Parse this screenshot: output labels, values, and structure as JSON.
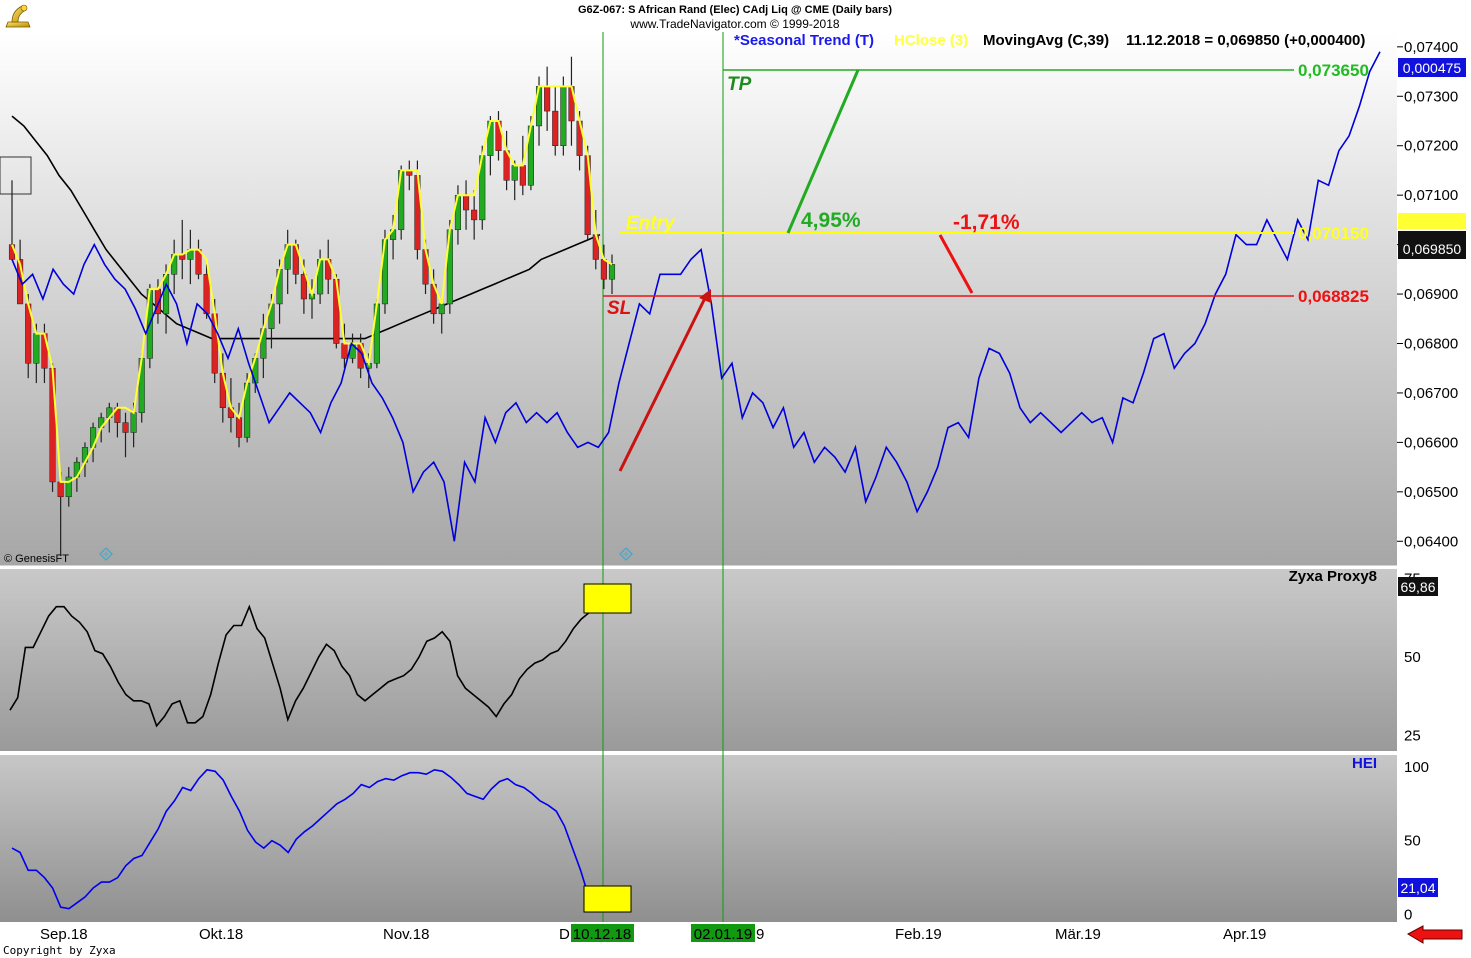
{
  "header": {
    "title": "G6Z-067:  S African Rand (Elec) CAdj Liq @ CME  (Daily bars)",
    "subtitle": "www.TradeNavigator.com © 1999-2018"
  },
  "legend": {
    "seasonal": "*Seasonal Trend (T)",
    "hclose": "HClose (3)",
    "ma": "MovingAvg (C,39)",
    "reading": "11.12.2018 = 0,069850 (+0,000400)"
  },
  "watermark": "© GenesisFT",
  "copyright": "Copyright by Zyxa",
  "colors": {
    "price_bg_top": "#ffffff",
    "price_bg_bottom": "#a8a8a8",
    "seasonal": "#0000dd",
    "hclose": "#ffff33",
    "ma": "#000000",
    "bull": "#22aa22",
    "bear": "#dd2222",
    "entry": "#ffff00",
    "tp": "#22aa22",
    "sl": "#ee1111",
    "hei": "#0000ee",
    "zyxa": "#000000",
    "date_box": "#119911"
  },
  "chart_data": [
    {
      "type": "candlestick",
      "panel": "price",
      "ylim": [
        0.0635,
        0.0743
      ],
      "y_ticks": [
        "0,07400",
        "0,07300",
        "0,07200",
        "0,07100",
        "0,07000",
        "0,06900",
        "0,06800",
        "0,06700",
        "0,06600",
        "0,06500",
        "0,06400"
      ],
      "y_tick_values": [
        0.074,
        0.073,
        0.072,
        0.071,
        0.07,
        0.069,
        0.068,
        0.067,
        0.066,
        0.065,
        0.064
      ],
      "x_ticks": [
        "Sep.18",
        "Okt.18",
        "Nov.18",
        "D",
        "Feb.19",
        "Mär.19",
        "Apr.19",
        "9"
      ],
      "ohlc": [
        [
          0.07,
          0.0713,
          0.0697,
          0.0697
        ],
        [
          0.0697,
          0.0701,
          0.0688,
          0.0688
        ],
        [
          0.0688,
          0.069,
          0.0673,
          0.0676
        ],
        [
          0.0676,
          0.0684,
          0.0672,
          0.0682
        ],
        [
          0.0682,
          0.0684,
          0.0672,
          0.0675
        ],
        [
          0.0675,
          0.0676,
          0.065,
          0.0652
        ],
        [
          0.0652,
          0.0654,
          0.0637,
          0.0649
        ],
        [
          0.0649,
          0.0655,
          0.0647,
          0.0653
        ],
        [
          0.0653,
          0.0657,
          0.065,
          0.0656
        ],
        [
          0.0656,
          0.066,
          0.0653,
          0.0659
        ],
        [
          0.0659,
          0.0664,
          0.0656,
          0.0663
        ],
        [
          0.0663,
          0.0666,
          0.066,
          0.0665
        ],
        [
          0.0665,
          0.0668,
          0.0662,
          0.0667
        ],
        [
          0.0667,
          0.0668,
          0.0661,
          0.0664
        ],
        [
          0.0664,
          0.0666,
          0.0657,
          0.0662
        ],
        [
          0.0662,
          0.0668,
          0.0659,
          0.0666
        ],
        [
          0.0666,
          0.0678,
          0.0664,
          0.0677
        ],
        [
          0.0677,
          0.0692,
          0.0675,
          0.0691
        ],
        [
          0.0691,
          0.0693,
          0.0684,
          0.0686
        ],
        [
          0.0686,
          0.0696,
          0.0682,
          0.0694
        ],
        [
          0.0694,
          0.0701,
          0.069,
          0.0698
        ],
        [
          0.0698,
          0.0705,
          0.0693,
          0.0697
        ],
        [
          0.0697,
          0.0703,
          0.0692,
          0.0699
        ],
        [
          0.0699,
          0.0701,
          0.0693,
          0.0694
        ],
        [
          0.0694,
          0.0696,
          0.0685,
          0.0686
        ],
        [
          0.0686,
          0.0689,
          0.0672,
          0.0674
        ],
        [
          0.0674,
          0.0678,
          0.0664,
          0.0667
        ],
        [
          0.0667,
          0.0673,
          0.0662,
          0.0665
        ],
        [
          0.0665,
          0.0668,
          0.0659,
          0.0661
        ],
        [
          0.0661,
          0.0674,
          0.066,
          0.0672
        ],
        [
          0.0672,
          0.0678,
          0.067,
          0.0677
        ],
        [
          0.0677,
          0.0686,
          0.0673,
          0.0683
        ],
        [
          0.0683,
          0.069,
          0.0679,
          0.0688
        ],
        [
          0.0688,
          0.0697,
          0.0684,
          0.0695
        ],
        [
          0.0695,
          0.0703,
          0.069,
          0.07
        ],
        [
          0.07,
          0.0701,
          0.0692,
          0.0694
        ],
        [
          0.0694,
          0.0697,
          0.0686,
          0.0689
        ],
        [
          0.0689,
          0.0693,
          0.0685,
          0.069
        ],
        [
          0.069,
          0.0699,
          0.0688,
          0.0697
        ],
        [
          0.0697,
          0.0701,
          0.069,
          0.0693
        ],
        [
          0.0693,
          0.0694,
          0.0679,
          0.068
        ],
        [
          0.068,
          0.0684,
          0.0675,
          0.0677
        ],
        [
          0.0677,
          0.0682,
          0.0676,
          0.068
        ],
        [
          0.068,
          0.0682,
          0.0673,
          0.0675
        ],
        [
          0.0675,
          0.0678,
          0.0671,
          0.0676
        ],
        [
          0.0676,
          0.0689,
          0.0675,
          0.0688
        ],
        [
          0.0688,
          0.0703,
          0.0686,
          0.0701
        ],
        [
          0.0701,
          0.0706,
          0.0697,
          0.0703
        ],
        [
          0.0703,
          0.0716,
          0.0701,
          0.0715
        ],
        [
          0.0715,
          0.0717,
          0.0711,
          0.0714
        ],
        [
          0.0714,
          0.0717,
          0.0697,
          0.0699
        ],
        [
          0.0699,
          0.0701,
          0.069,
          0.0692
        ],
        [
          0.0692,
          0.0695,
          0.0684,
          0.0686
        ],
        [
          0.0686,
          0.0689,
          0.0682,
          0.0688
        ],
        [
          0.0688,
          0.0705,
          0.0686,
          0.0703
        ],
        [
          0.0703,
          0.0712,
          0.07,
          0.071
        ],
        [
          0.071,
          0.0713,
          0.0703,
          0.0707
        ],
        [
          0.0707,
          0.0711,
          0.0701,
          0.0705
        ],
        [
          0.0705,
          0.072,
          0.0703,
          0.0718
        ],
        [
          0.0718,
          0.0726,
          0.0714,
          0.0725
        ],
        [
          0.0725,
          0.0727,
          0.0717,
          0.0719
        ],
        [
          0.0719,
          0.0723,
          0.0711,
          0.0713
        ],
        [
          0.0713,
          0.0717,
          0.0709,
          0.0716
        ],
        [
          0.0716,
          0.0722,
          0.071,
          0.0712
        ],
        [
          0.0712,
          0.0726,
          0.0711,
          0.0724
        ],
        [
          0.0724,
          0.0734,
          0.072,
          0.0732
        ],
        [
          0.0732,
          0.0736,
          0.0723,
          0.0727
        ],
        [
          0.0727,
          0.0732,
          0.0718,
          0.072
        ],
        [
          0.072,
          0.0734,
          0.0718,
          0.0732
        ],
        [
          0.0732,
          0.0738,
          0.072,
          0.0725
        ],
        [
          0.0725,
          0.0727,
          0.0715,
          0.0718
        ],
        [
          0.0718,
          0.072,
          0.0701,
          0.0702
        ],
        [
          0.0702,
          0.0707,
          0.0695,
          0.0697
        ],
        [
          0.0697,
          0.07,
          0.0691,
          0.0693
        ],
        [
          0.0693,
          0.0698,
          0.069,
          0.0696
        ]
      ],
      "hclose": [
        0.07,
        0.0696,
        0.0688,
        0.0682,
        0.0682,
        0.0675,
        0.0652,
        0.0652,
        0.0653,
        0.0656,
        0.0659,
        0.0663,
        0.0665,
        0.0667,
        0.0667,
        0.0666,
        0.0677,
        0.0691,
        0.0691,
        0.0694,
        0.0698,
        0.0698,
        0.0699,
        0.0699,
        0.0697,
        0.0686,
        0.0674,
        0.0667,
        0.0665,
        0.0672,
        0.0677,
        0.0683,
        0.0688,
        0.0695,
        0.07,
        0.07,
        0.0695,
        0.069,
        0.0697,
        0.0697,
        0.0693,
        0.068,
        0.068,
        0.068,
        0.0676,
        0.0688,
        0.0701,
        0.0703,
        0.0715,
        0.0715,
        0.0715,
        0.0699,
        0.0692,
        0.0688,
        0.0703,
        0.071,
        0.071,
        0.071,
        0.0718,
        0.0725,
        0.0725,
        0.0719,
        0.0716,
        0.0716,
        0.0724,
        0.0732,
        0.0732,
        0.0732,
        0.0732,
        0.0732,
        0.0725,
        0.0718,
        0.0702,
        0.0697,
        0.0696
      ],
      "ma39": [
        0.0726,
        0.0724,
        0.0721,
        0.0718,
        0.0714,
        0.0711,
        0.0707,
        0.0703,
        0.0699,
        0.0696,
        0.0693,
        0.069,
        0.0688,
        0.0686,
        0.0684,
        0.0683,
        0.0682,
        0.0681,
        0.0681,
        0.0681,
        0.0681,
        0.0681,
        0.0681,
        0.0681,
        0.0681,
        0.0681,
        0.0681,
        0.0681,
        0.0681,
        0.0681,
        0.0681,
        0.0682,
        0.0683,
        0.0684,
        0.0685,
        0.0686,
        0.0687,
        0.0688,
        0.0689,
        0.069,
        0.0691,
        0.0692,
        0.0693,
        0.0694,
        0.0695,
        0.0697,
        0.0698,
        0.0699,
        0.07,
        0.0701,
        0.0702
      ],
      "seasonal": [
        0.0697,
        0.0692,
        0.0694,
        0.0689,
        0.0695,
        0.0692,
        0.069,
        0.0696,
        0.07,
        0.0696,
        0.0693,
        0.0691,
        0.0687,
        0.0682,
        0.0687,
        0.0692,
        0.0688,
        0.068,
        0.0688,
        0.0686,
        0.0682,
        0.0677,
        0.0683,
        0.0676,
        0.067,
        0.0664,
        0.0667,
        0.067,
        0.0668,
        0.0666,
        0.0662,
        0.0668,
        0.0672,
        0.068,
        0.0678,
        0.0672,
        0.0669,
        0.0665,
        0.066,
        0.065,
        0.0654,
        0.0656,
        0.0652,
        0.064,
        0.0656,
        0.0652,
        0.0665,
        0.066,
        0.0666,
        0.0668,
        0.0664,
        0.0666,
        0.0664,
        0.0666,
        0.0662,
        0.0659,
        0.066,
        0.0659,
        0.0662,
        0.0672,
        0.068,
        0.0688,
        0.0686,
        0.0694,
        0.0694,
        0.0694,
        0.0697,
        0.0699,
        0.0688,
        0.0673,
        0.0676,
        0.0665,
        0.067,
        0.0668,
        0.0663,
        0.0667,
        0.0659,
        0.0662,
        0.0656,
        0.0659,
        0.0657,
        0.0654,
        0.0659,
        0.0648,
        0.0653,
        0.0659,
        0.0656,
        0.0652,
        0.0646,
        0.065,
        0.0655,
        0.0663,
        0.0664,
        0.0661,
        0.0673,
        0.0679,
        0.0678,
        0.0674,
        0.0667,
        0.0664,
        0.0666,
        0.0664,
        0.0662,
        0.0664,
        0.0666,
        0.0664,
        0.0665,
        0.066,
        0.0669,
        0.0668,
        0.0674,
        0.0681,
        0.0682,
        0.0675,
        0.0678,
        0.068,
        0.0684,
        0.069,
        0.0694,
        0.0702,
        0.07,
        0.07,
        0.0705,
        0.0701,
        0.0697,
        0.0705,
        0.0701,
        0.0713,
        0.0712,
        0.0719,
        0.0722,
        0.0728,
        0.0735,
        0.0739
      ],
      "levels": [
        {
          "label": "TP",
          "value": "0,073650"
        },
        {
          "label": "Entry",
          "value": "0,070150"
        },
        {
          "label": "SL",
          "value": "0,068825"
        }
      ],
      "percents": [
        "4,95%",
        "-1,71%"
      ],
      "price_box": "0,069850",
      "top_box": "0,000475",
      "dates": [
        "10.12.18",
        "02.01.19"
      ]
    },
    {
      "type": "line",
      "panel": "zyxa",
      "name": "Zyxa Proxy8",
      "ylim": [
        20,
        78
      ],
      "y_ticks": [
        "75",
        "50",
        "25"
      ],
      "y_tick_values": [
        75,
        50,
        25
      ],
      "current": "69,86",
      "values": [
        33,
        37,
        53,
        53,
        58,
        63,
        66,
        66,
        63,
        61,
        58,
        52,
        51,
        47,
        42,
        38,
        36,
        36,
        35,
        28,
        31,
        35,
        36,
        29,
        29,
        31,
        38,
        48,
        57,
        60,
        60,
        66,
        59,
        56,
        48,
        40,
        30,
        36,
        40,
        45,
        50,
        54,
        52,
        47,
        44,
        38,
        36,
        38,
        40,
        42,
        43,
        44,
        46,
        50,
        55,
        56,
        58,
        55,
        44,
        40,
        38,
        36,
        34,
        31,
        35,
        38,
        43,
        46,
        48,
        49,
        51,
        52,
        55,
        59,
        62,
        64,
        66,
        70,
        73
      ]
    },
    {
      "type": "line",
      "panel": "hei",
      "name": "HEI",
      "ylim": [
        -5,
        108
      ],
      "y_ticks": [
        "100",
        "50",
        "0"
      ],
      "y_tick_values": [
        100,
        50,
        0
      ],
      "current": "21,04",
      "values": [
        45,
        42,
        30,
        30,
        25,
        18,
        5,
        4,
        8,
        12,
        18,
        22,
        22,
        25,
        33,
        38,
        40,
        49,
        58,
        70,
        77,
        86,
        84,
        92,
        98,
        97,
        91,
        80,
        70,
        57,
        49,
        45,
        50,
        47,
        42,
        51,
        56,
        60,
        65,
        70,
        75,
        78,
        82,
        88,
        86,
        90,
        92,
        91,
        94,
        96,
        96,
        95,
        98,
        97,
        93,
        88,
        82,
        80,
        78,
        85,
        90,
        92,
        88,
        86,
        82,
        77,
        74,
        70,
        60,
        45,
        30,
        12,
        5,
        2
      ]
    }
  ]
}
